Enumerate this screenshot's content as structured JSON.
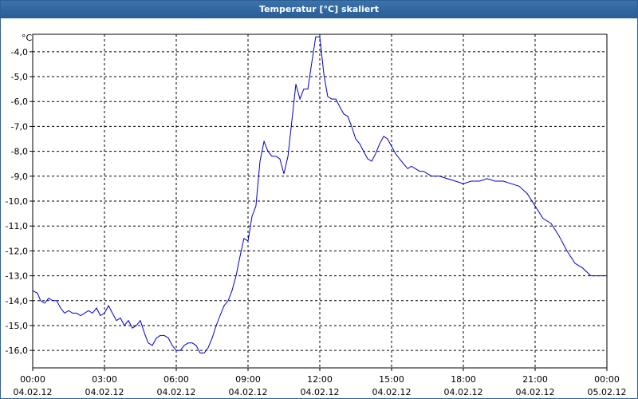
{
  "window": {
    "title": "Temperatur [°C] skaliert"
  },
  "chart_data": {
    "type": "line",
    "title": "Temperatur [°C] skaliert",
    "ylabel": "°C",
    "xlabel": "",
    "ylim": [
      -16.7,
      -3.3
    ],
    "xlim": [
      0,
      24
    ],
    "y_ticks": [
      -4,
      -5,
      -6,
      -7,
      -8,
      -9,
      -10,
      -11,
      -12,
      -13,
      -14,
      -15,
      -16
    ],
    "y_tick_labels": [
      "-4,0",
      "-5,0",
      "-6,0",
      "-7,0",
      "-8,0",
      "-9,0",
      "-10,0",
      "-11,0",
      "-12,0",
      "-13,0",
      "-14,0",
      "-15,0",
      "-16,0"
    ],
    "x_ticks": [
      0,
      3,
      6,
      9,
      12,
      15,
      18,
      21,
      24
    ],
    "x_tick_labels": [
      {
        "time": "00:00",
        "date": "04.02.12"
      },
      {
        "time": "03:00",
        "date": "04.02.12"
      },
      {
        "time": "06:00",
        "date": "04.02.12"
      },
      {
        "time": "09:00",
        "date": "04.02.12"
      },
      {
        "time": "12:00",
        "date": "04.02.12"
      },
      {
        "time": "15:00",
        "date": "04.02.12"
      },
      {
        "time": "18:00",
        "date": "04.02.12"
      },
      {
        "time": "21:00",
        "date": "04.02.12"
      },
      {
        "time": "00:00",
        "date": "05.02.12"
      }
    ],
    "grid": true,
    "series": [
      {
        "color": "#0000c8",
        "x": [
          0,
          0.2,
          0.33,
          0.5,
          0.67,
          0.83,
          1.0,
          1.17,
          1.33,
          1.5,
          1.67,
          1.83,
          2.0,
          2.17,
          2.33,
          2.5,
          2.67,
          2.83,
          3.0,
          3.17,
          3.33,
          3.5,
          3.67,
          3.83,
          4.0,
          4.17,
          4.33,
          4.5,
          4.67,
          4.83,
          5.0,
          5.17,
          5.33,
          5.5,
          5.67,
          5.83,
          6.0,
          6.17,
          6.33,
          6.5,
          6.67,
          6.83,
          7.0,
          7.17,
          7.33,
          7.5,
          7.67,
          7.83,
          8.0,
          8.17,
          8.33,
          8.5,
          8.67,
          8.83,
          9.0,
          9.17,
          9.33,
          9.5,
          9.67,
          9.83,
          10.0,
          10.17,
          10.33,
          10.5,
          10.67,
          10.83,
          11.0,
          11.17,
          11.33,
          11.5,
          11.67,
          11.83,
          12.0,
          12.17,
          12.33,
          12.5,
          12.67,
          12.83,
          13.0,
          13.17,
          13.33,
          13.5,
          13.67,
          13.83,
          14.0,
          14.17,
          14.33,
          14.5,
          14.67,
          14.83,
          15.0,
          15.17,
          15.33,
          15.5,
          15.67,
          15.83,
          16.0,
          16.17,
          16.33,
          16.5,
          16.67,
          16.83,
          17.0,
          17.33,
          17.67,
          18.0,
          18.33,
          18.67,
          19.0,
          19.33,
          19.67,
          20.0,
          20.33,
          20.67,
          21.0,
          21.33,
          21.67,
          22.0,
          22.33,
          22.67,
          23.0,
          23.33,
          23.67,
          24.0
        ],
        "y": [
          -13.6,
          -13.7,
          -14.0,
          -14.1,
          -13.9,
          -14.0,
          -14.0,
          -14.3,
          -14.5,
          -14.4,
          -14.5,
          -14.5,
          -14.6,
          -14.5,
          -14.4,
          -14.5,
          -14.3,
          -14.6,
          -14.5,
          -14.2,
          -14.5,
          -14.8,
          -14.7,
          -15.0,
          -14.8,
          -15.1,
          -15.0,
          -14.8,
          -15.3,
          -15.7,
          -15.8,
          -15.5,
          -15.4,
          -15.4,
          -15.5,
          -15.8,
          -16.0,
          -16.0,
          -15.8,
          -15.7,
          -15.7,
          -15.8,
          -16.1,
          -16.1,
          -15.9,
          -15.5,
          -15.0,
          -14.6,
          -14.2,
          -14.0,
          -13.6,
          -13.0,
          -12.2,
          -11.5,
          -11.6,
          -10.6,
          -10.2,
          -8.4,
          -7.6,
          -8.0,
          -8.2,
          -8.2,
          -8.3,
          -8.9,
          -8.2,
          -6.8,
          -5.3,
          -5.9,
          -5.5,
          -5.5,
          -4.4,
          -3.4,
          -3.4,
          -4.9,
          -5.8,
          -5.9,
          -5.9,
          -6.2,
          -6.5,
          -6.6,
          -7.0,
          -7.5,
          -7.7,
          -8.0,
          -8.3,
          -8.4,
          -8.1,
          -7.7,
          -7.4,
          -7.5,
          -7.8,
          -8.1,
          -8.3,
          -8.5,
          -8.7,
          -8.6,
          -8.7,
          -8.8,
          -8.8,
          -8.9,
          -9.0,
          -9.0,
          -9.0,
          -9.1,
          -9.2,
          -9.3,
          -9.2,
          -9.2,
          -9.1,
          -9.2,
          -9.2,
          -9.3,
          -9.4,
          -9.7,
          -10.2,
          -10.7,
          -10.9,
          -11.4,
          -12.0,
          -12.5,
          -12.7,
          -13.0,
          -13.0,
          -13.0
        ]
      }
    ]
  }
}
